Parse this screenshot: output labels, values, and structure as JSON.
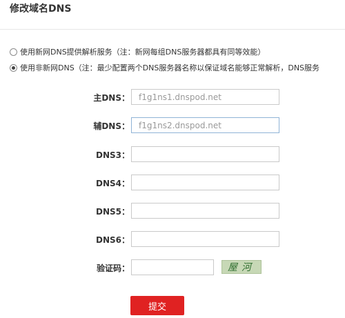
{
  "title": "修改域名DNS",
  "options": [
    {
      "label": "使用新网DNS提供解析服务（注：新网每组DNS服务器都具有同等效能）",
      "checked": false
    },
    {
      "label": "使用非新网DNS（注：最少配置两个DNS服务器名称以保证域名能够正常解析，DNS服务",
      "checked": true
    }
  ],
  "fields": {
    "dns1": {
      "label": "主DNS：",
      "value": "f1g1ns1.dnspod.net"
    },
    "dns2": {
      "label": "辅DNS：",
      "value": "f1g1ns2.dnspod.net"
    },
    "dns3": {
      "label": "DNS3：",
      "value": ""
    },
    "dns4": {
      "label": "DNS4：",
      "value": ""
    },
    "dns5": {
      "label": "DNS5：",
      "value": ""
    },
    "dns6": {
      "label": "DNS6：",
      "value": ""
    }
  },
  "captcha": {
    "label": "验证码：",
    "value": "",
    "image_text": "屋河"
  },
  "submit_label": "提交"
}
